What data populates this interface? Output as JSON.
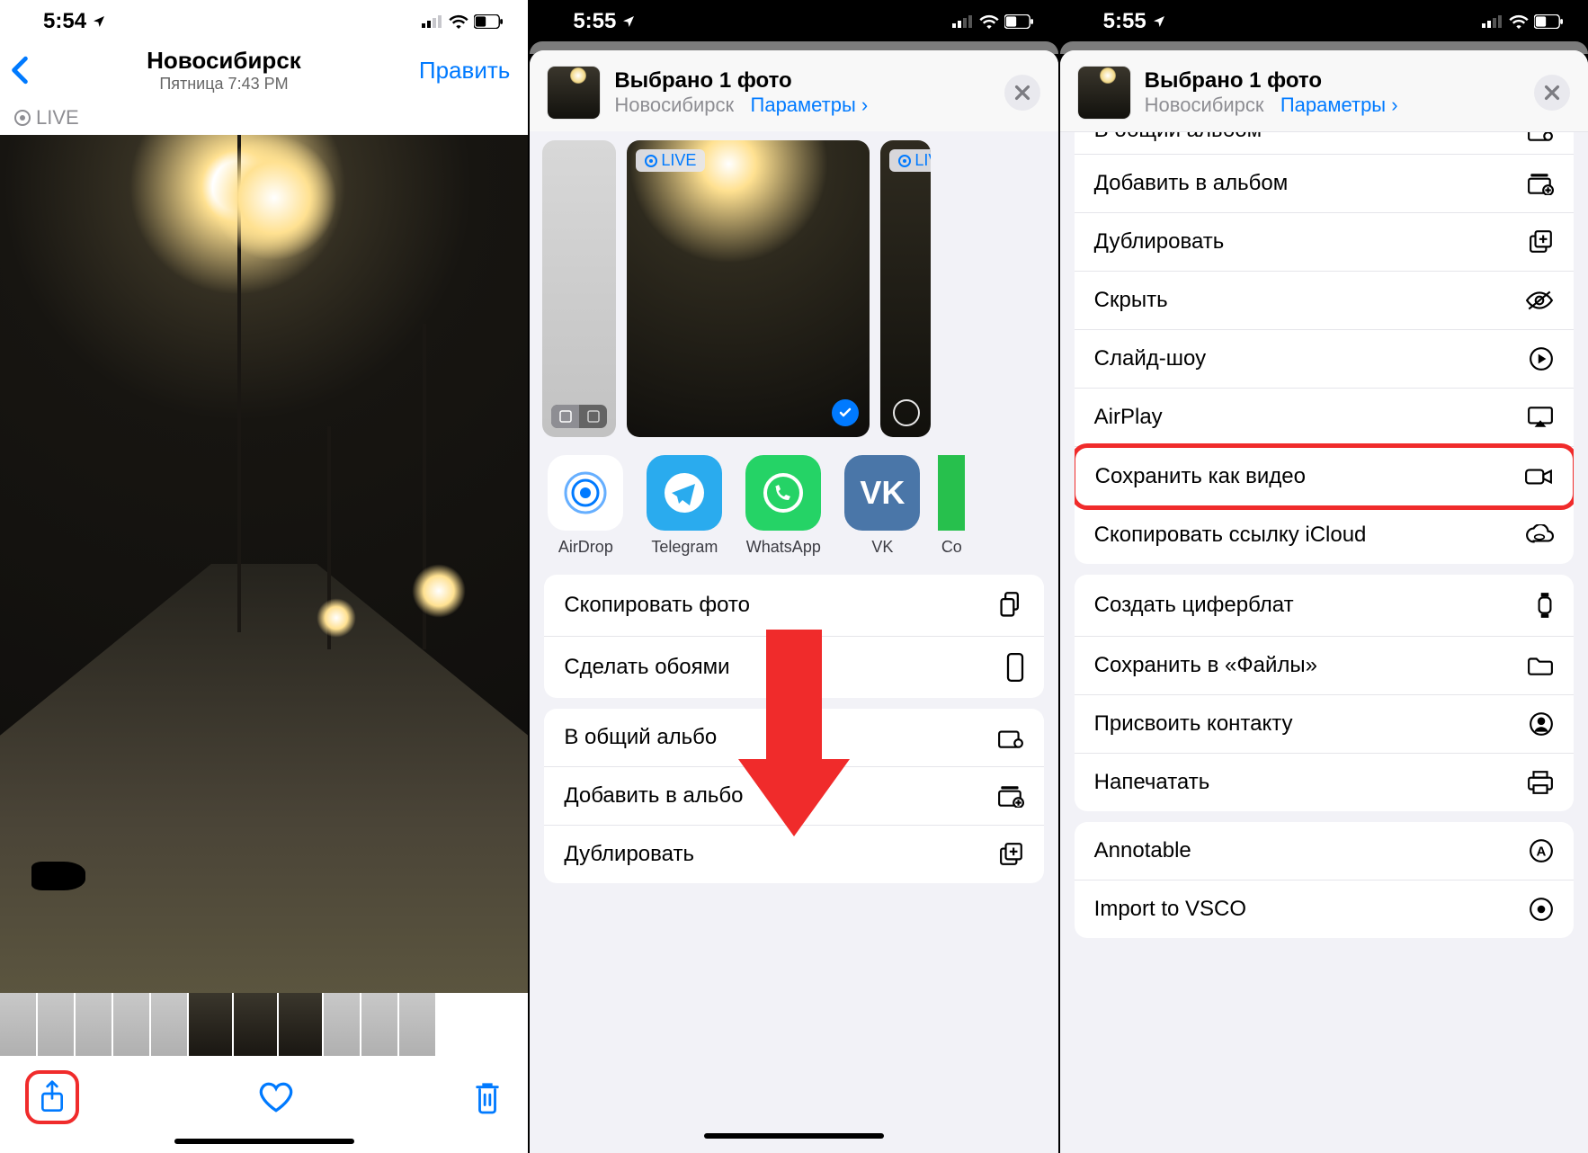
{
  "panel1": {
    "status": {
      "time": "5:54"
    },
    "nav": {
      "title": "Новосибирск",
      "subtitle": "Пятница 7:43 PM",
      "edit": "Править"
    },
    "live": "LIVE"
  },
  "panel2": {
    "status": {
      "time": "5:55"
    },
    "header": {
      "title": "Выбрано 1 фото",
      "location": "Новосибирск",
      "options": "Параметры"
    },
    "live": "LIVE",
    "live_side": "LIVE",
    "apps": {
      "airdrop": "AirDrop",
      "telegram": "Telegram",
      "whatsapp": "WhatsApp",
      "vk": "VK",
      "co": "Co"
    },
    "actions": {
      "copy_photo": "Скопировать фото",
      "wallpaper": "Сделать обоями",
      "shared_album": "В общий альбо",
      "add_album": "Добавить в альбо",
      "duplicate": "Дублировать"
    }
  },
  "panel3": {
    "status": {
      "time": "5:55"
    },
    "header": {
      "title": "Выбрано 1 фото",
      "location": "Новосибирск",
      "options": "Параметры"
    },
    "actions": {
      "shared_album": "В общий альбом",
      "add_album": "Добавить в альбом",
      "duplicate": "Дублировать",
      "hide": "Скрыть",
      "slideshow": "Слайд-шоу",
      "airplay": "AirPlay",
      "save_video": "Сохранить как видео",
      "copy_icloud": "Скопировать ссылку iCloud",
      "watch_face": "Создать циферблат",
      "save_files": "Сохранить в «Файлы»",
      "assign_contact": "Присвоить контакту",
      "print": "Напечатать",
      "annotable": "Annotable",
      "vsco": "Import to VSCO"
    }
  }
}
